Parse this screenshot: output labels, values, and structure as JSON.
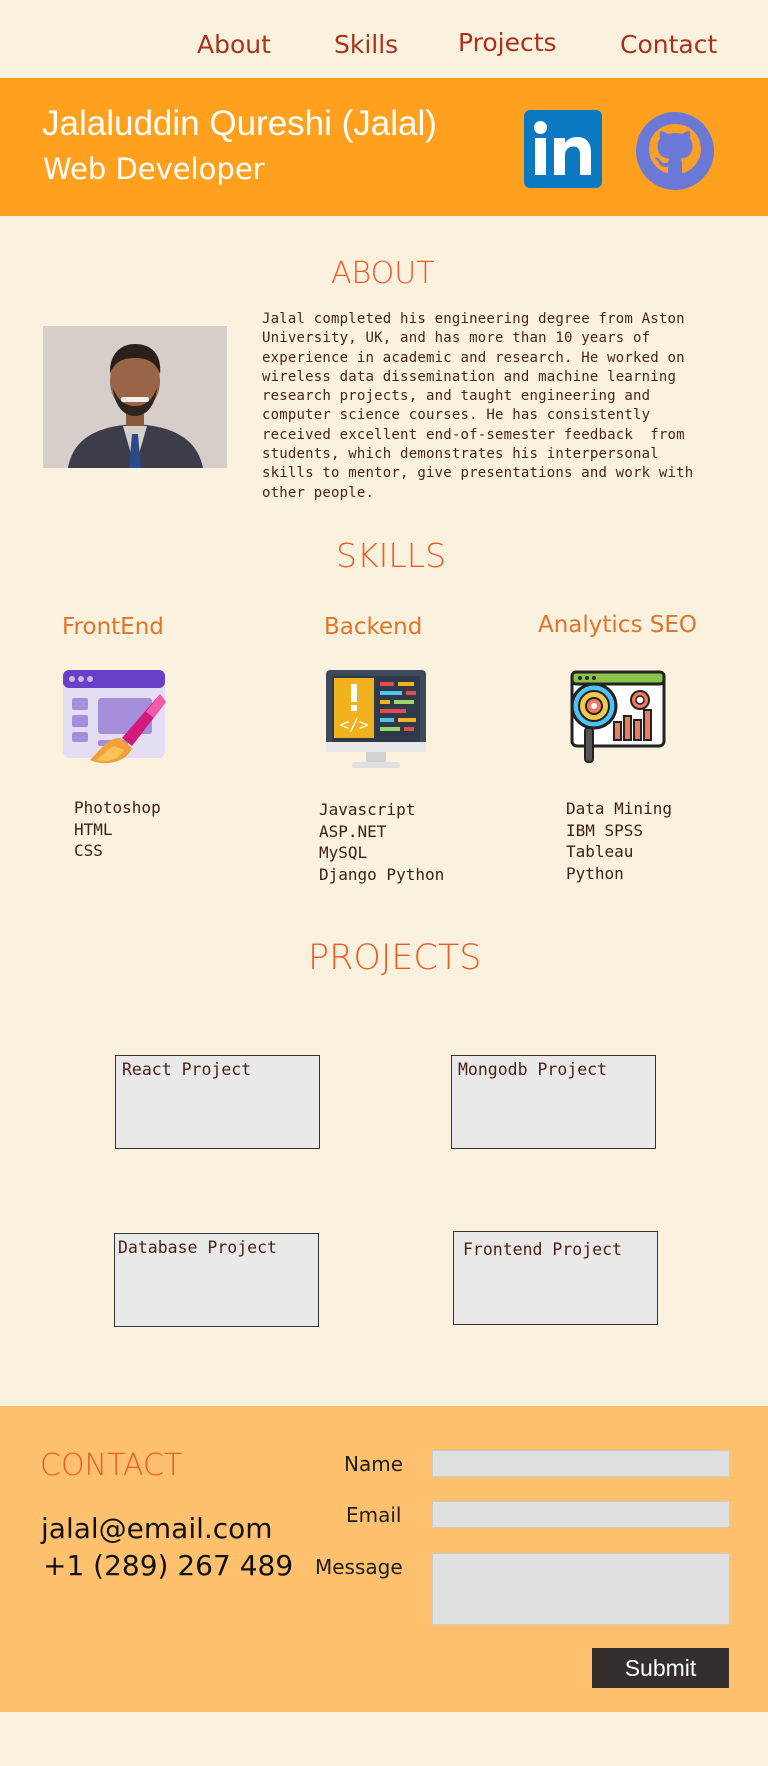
{
  "nav": {
    "about": "About",
    "skills": "Skills",
    "projects": "Projects",
    "contact": "Contact"
  },
  "header": {
    "name": "Jalaluddin Qureshi (Jalal)",
    "role": "Web Developer",
    "linkedin_icon": "linkedin-icon",
    "github_icon": "github-icon"
  },
  "about": {
    "title": "ABOUT",
    "lines": [
      "Jalal completed his engineering degree from Aston",
      "University, UK, and has more than 10 years of",
      "experience in academic and research. He worked on",
      "wireless data dissemination and machine learning",
      "research projects, and taught engineering and",
      "computer science courses. He has consistently",
      "received excellent end-of-semester feedback  from",
      "students, which demonstrates his interpersonal",
      "skills to mentor, give presentations and work with",
      "other people."
    ]
  },
  "skills": {
    "title": "SKILLS",
    "groups": [
      {
        "title": "FrontEnd",
        "icon": "design-brush-icon",
        "items": [
          "Photoshop",
          "HTML",
          "CSS"
        ]
      },
      {
        "title": "Backend",
        "icon": "code-monitor-icon",
        "items": [
          "Javascript",
          "ASP.NET",
          "MySQL",
          "Django Python"
        ]
      },
      {
        "title": "Analytics SEO",
        "icon": "analytics-magnifier-icon",
        "items": [
          "Data Mining",
          "IBM SPSS",
          "Tableau",
          "Python"
        ]
      }
    ]
  },
  "projects": {
    "title": "PROJECTS",
    "items": [
      {
        "label": "React Project"
      },
      {
        "label": "Mongodb Project"
      },
      {
        "label": "Database Project"
      },
      {
        "label": "Frontend Project"
      }
    ]
  },
  "contact": {
    "title": "CONTACT",
    "email": "jalal@email.com",
    "phone": "+1 (289) 267 489",
    "fields": {
      "name_label": "Name",
      "email_label": "Email",
      "message_label": "Message",
      "name_value": "",
      "email_value": "",
      "message_value": ""
    },
    "submit_label": "Submit"
  },
  "colors": {
    "accent": "#FFA11F",
    "heading": "#F05A22",
    "background": "#FAF2DE",
    "contact_bg": "#FFC16E",
    "button": "#342E2C"
  }
}
